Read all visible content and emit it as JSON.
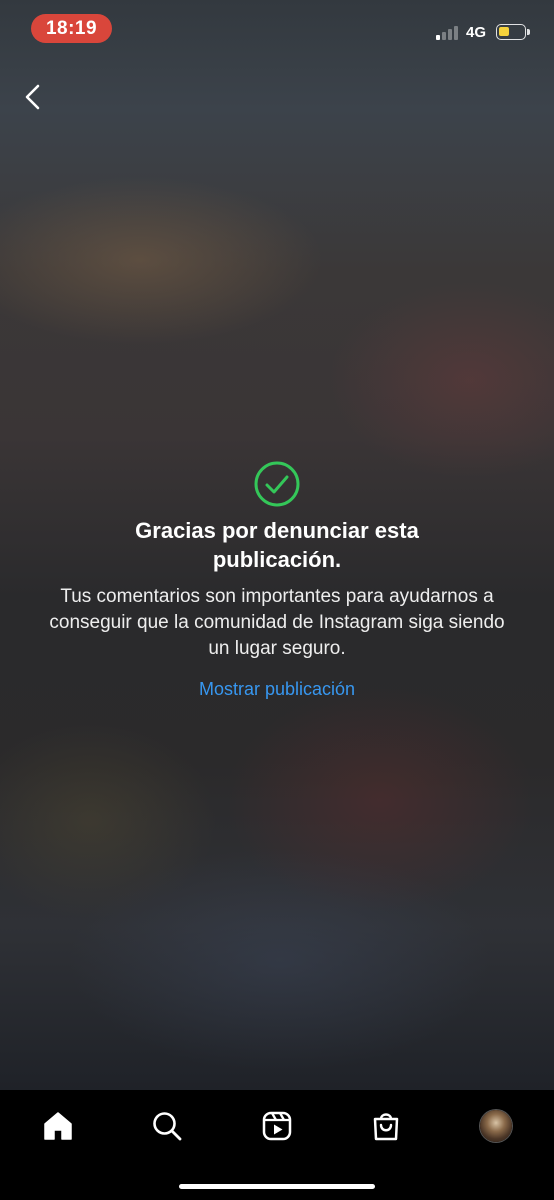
{
  "status_bar": {
    "time": "18:19",
    "network": "4G",
    "signal_bars_active": 1,
    "signal_bars_total": 4,
    "battery_level": 0.45,
    "battery_color": "#f5d23c",
    "time_pill_color": "#d9463b"
  },
  "header": {
    "back_icon": "chevron-left-icon"
  },
  "confirmation": {
    "icon": "check-circle-icon",
    "icon_color": "#34c759",
    "title": "Gracias por denunciar esta publicación.",
    "body": "Tus comentarios son importantes para ayudarnos a conseguir que la comunidad de Instagram siga siendo un lugar seguro.",
    "link_label": "Mostrar publicación",
    "link_color": "#3797f0"
  },
  "bottom_nav": {
    "items": [
      {
        "icon": "home-icon",
        "active": true
      },
      {
        "icon": "search-icon"
      },
      {
        "icon": "reels-icon"
      },
      {
        "icon": "shop-icon"
      },
      {
        "icon": "profile-avatar"
      }
    ]
  }
}
